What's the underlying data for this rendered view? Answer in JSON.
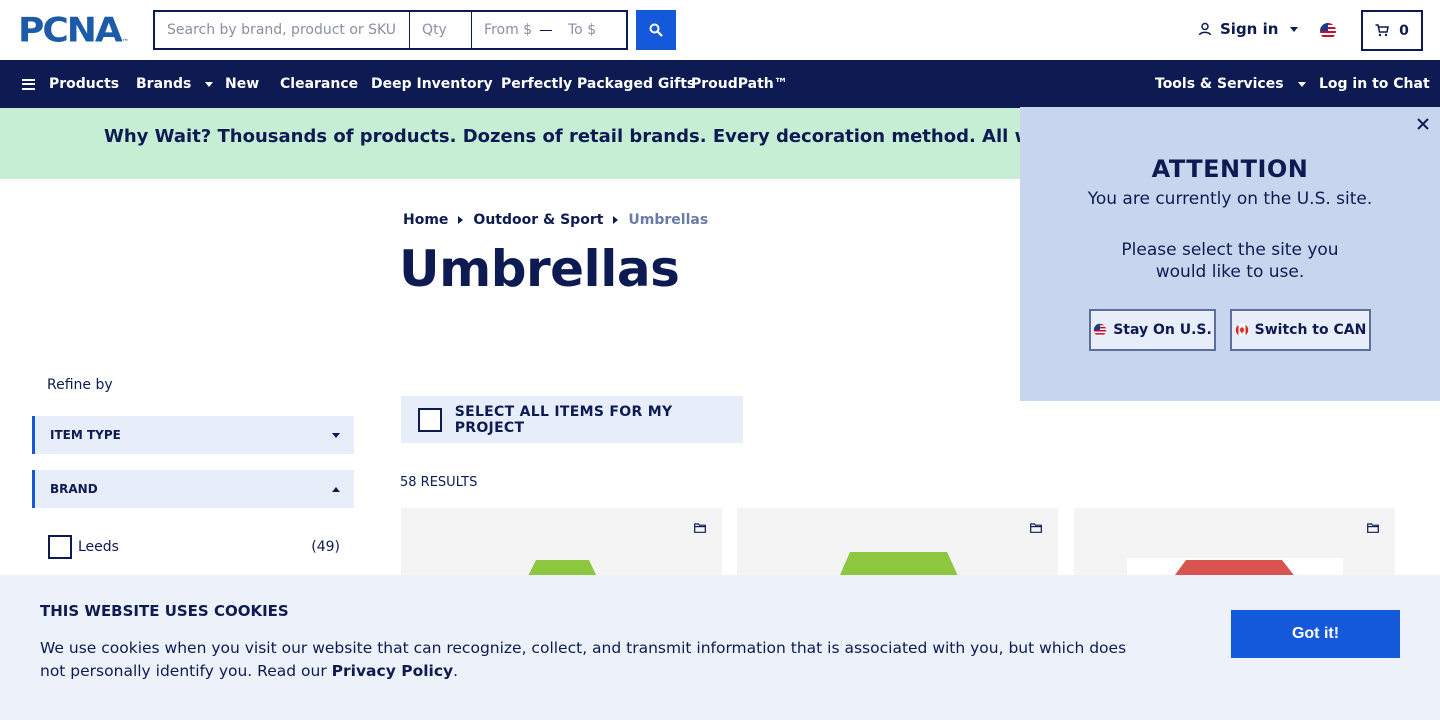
{
  "header": {
    "logo_text": "PCNA",
    "logo_tm": "™",
    "search_placeholder": "Search by brand, product or SKU",
    "qty_placeholder": "Qty",
    "from_placeholder": "From $",
    "to_placeholder": "To $",
    "signin_label": "Sign in",
    "cart_count": "0"
  },
  "nav": {
    "items": [
      "Products",
      "Brands",
      "New",
      "Clearance",
      "Deep Inventory",
      "Perfectly Packaged Gifts",
      "ProudPath™"
    ],
    "tools_label": "Tools & Services",
    "chat_label": "Log in to Chat"
  },
  "promo": {
    "text": "Why Wait? Thousands of products. Dozens of retail brands. Every decoration method. All with a standard"
  },
  "breadcrumb": [
    "Home",
    "Outdoor & Sport",
    "Umbrellas"
  ],
  "page_title": "Umbrellas",
  "sidebar": {
    "refine_label": "Refine by",
    "facets": [
      "ITEM TYPE",
      "BRAND"
    ],
    "brand_options": [
      {
        "label": "Leeds",
        "count": "(49)"
      }
    ]
  },
  "select_all_label": "SELECT ALL ITEMS FOR MY PROJECT",
  "results_label": "58 RESULTS",
  "products": [
    {
      "color": "#8dc63f"
    },
    {
      "color": "#8dc63f"
    },
    {
      "color": "#d9534f"
    }
  ],
  "site_modal": {
    "title": "ATTENTION",
    "line1": "You are currently on the U.S. site.",
    "line2": "Please select the site you would like to use.",
    "stay_label": "Stay On U.S.",
    "switch_label": "Switch to CAN"
  },
  "cookie": {
    "title": "THIS WEBSITE USES COOKIES",
    "text_before": "We use cookies when you visit our website that can recognize, collect, and transmit information that is associated with you, but which does not personally identify you. Read our ",
    "link_label": "Privacy Policy",
    "text_after": ".",
    "button_label": "Got it!"
  },
  "colors": {
    "navy": "#0d1b52",
    "accent_blue": "#1459d9",
    "promo_green": "#c5eed5",
    "modal_bg": "#c8d5ee"
  }
}
